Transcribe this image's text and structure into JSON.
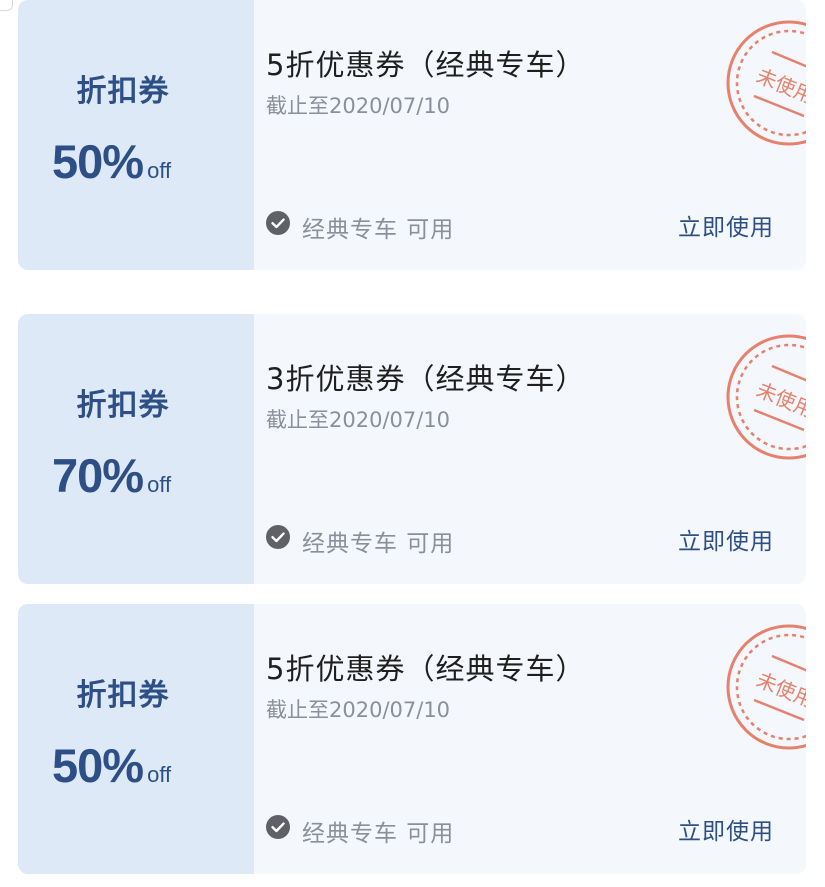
{
  "coupons": [
    {
      "type_label": "折扣券",
      "percent": "70%",
      "off_label": "off",
      "title": "3折优惠券（经典专车）",
      "expiry": "截止至2020/07/10",
      "scope": "经典专车 可用",
      "action": "立即使用",
      "status": "未使用"
    },
    {
      "type_label": "折扣券",
      "percent": "50%",
      "off_label": "off",
      "title": "5折优惠券（经典专车）",
      "expiry": "截止至2020/07/10",
      "scope": "经典专车 可用",
      "action": "立即使用",
      "status": "未使用"
    },
    {
      "type_label": "折扣券",
      "percent": "50%",
      "off_label": "off",
      "title": "5折优惠券（经典专车）",
      "expiry": "截止至2020/07/10",
      "scope": "经典专车 可用",
      "action": "立即使用",
      "status": "未使用"
    }
  ],
  "colors": {
    "stub_background": "#dde9f6",
    "brand_blue": "#2e4f86",
    "stamp_red": "#e7806c",
    "card_background": "#f4f7fb",
    "muted_text": "#8a8f99"
  },
  "icons": {
    "available": "check-circle-icon",
    "status_stamp": "unused-stamp-icon"
  }
}
